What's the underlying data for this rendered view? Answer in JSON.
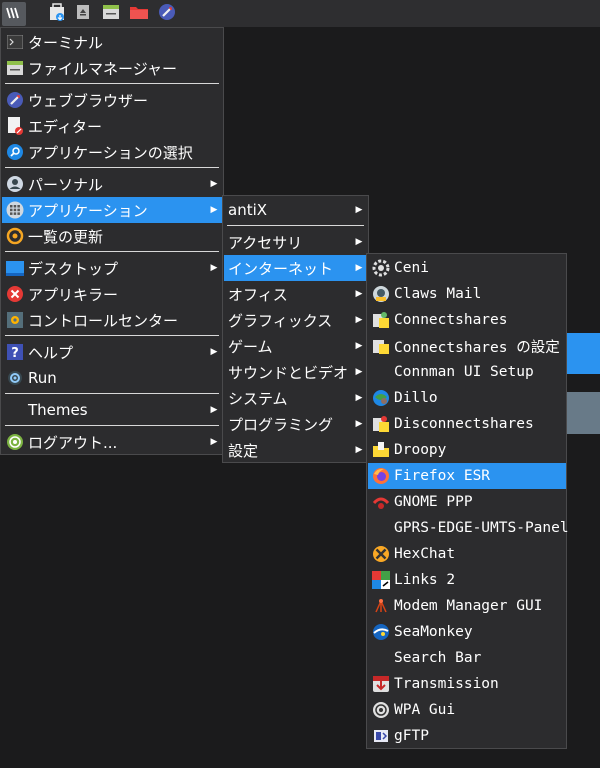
{
  "taskbar": {
    "items": [
      {
        "icon": "antix-menu-icon"
      },
      {
        "icon": "package-installer-icon"
      },
      {
        "icon": "eject-icon"
      },
      {
        "icon": "file-manager-icon"
      },
      {
        "icon": "folder-icon"
      },
      {
        "icon": "web-browser-icon"
      }
    ]
  },
  "main_menu": {
    "items": [
      {
        "label": "ターミナル",
        "icon": "terminal-icon"
      },
      {
        "label": "ファイルマネージャー",
        "icon": "file-manager-icon"
      },
      {
        "label": "ウェブブラウザー",
        "icon": "web-browser-icon"
      },
      {
        "label": "エディター",
        "icon": "editor-icon"
      },
      {
        "label": "アプリケーションの選択",
        "icon": "app-select-icon"
      },
      {
        "label": "パーソナル",
        "icon": "personal-icon"
      },
      {
        "label": "アプリケーション",
        "icon": "applications-icon"
      },
      {
        "label": "一覧の更新",
        "icon": "refresh-icon"
      },
      {
        "label": "デスクトップ",
        "icon": "desktop-icon"
      },
      {
        "label": "アプリキラー",
        "icon": "app-killer-icon"
      },
      {
        "label": "コントロールセンター",
        "icon": "control-center-icon"
      },
      {
        "label": "ヘルプ",
        "icon": "help-icon"
      },
      {
        "label": "Run",
        "icon": "run-icon"
      },
      {
        "label": "Themes",
        "icon": ""
      },
      {
        "label": "ログアウト...",
        "icon": "logout-icon"
      }
    ]
  },
  "apps_menu": {
    "items": [
      {
        "label": "antiX"
      },
      {
        "label": "アクセサリ"
      },
      {
        "label": "インターネット"
      },
      {
        "label": "オフィス"
      },
      {
        "label": "グラフィックス"
      },
      {
        "label": "ゲーム"
      },
      {
        "label": "サウンドとビデオ"
      },
      {
        "label": "システム"
      },
      {
        "label": "プログラミング"
      },
      {
        "label": "設定"
      }
    ]
  },
  "internet_menu": {
    "items": [
      {
        "label": "Ceni",
        "icon": "ceni-icon"
      },
      {
        "label": "Claws Mail",
        "icon": "claws-mail-icon"
      },
      {
        "label": "Connectshares",
        "icon": "connectshares-icon"
      },
      {
        "label": "Connectshares の設定",
        "icon": "connectshares-config-icon"
      },
      {
        "label": "Connman UI Setup",
        "icon": ""
      },
      {
        "label": "Dillo",
        "icon": "dillo-icon"
      },
      {
        "label": "Disconnectshares",
        "icon": "disconnectshares-icon"
      },
      {
        "label": "Droopy",
        "icon": "droopy-icon"
      },
      {
        "label": "Firefox ESR",
        "icon": "firefox-icon"
      },
      {
        "label": "GNOME PPP",
        "icon": "gnome-ppp-icon"
      },
      {
        "label": "GPRS-EDGE-UMTS-Panel",
        "icon": ""
      },
      {
        "label": "HexChat",
        "icon": "hexchat-icon"
      },
      {
        "label": "Links 2",
        "icon": "links2-icon"
      },
      {
        "label": "Modem Manager GUI",
        "icon": "modem-manager-icon"
      },
      {
        "label": "SeaMonkey",
        "icon": "seamonkey-icon"
      },
      {
        "label": "Search Bar",
        "icon": ""
      },
      {
        "label": "Transmission",
        "icon": "transmission-icon"
      },
      {
        "label": "WPA Gui",
        "icon": "wpa-gui-icon"
      },
      {
        "label": "gFTP",
        "icon": "gftp-icon"
      }
    ]
  },
  "colors": {
    "selection": "#2b93f0",
    "menu_bg": "#2c2c2e",
    "desktop_bg": "#1b1b1c"
  }
}
